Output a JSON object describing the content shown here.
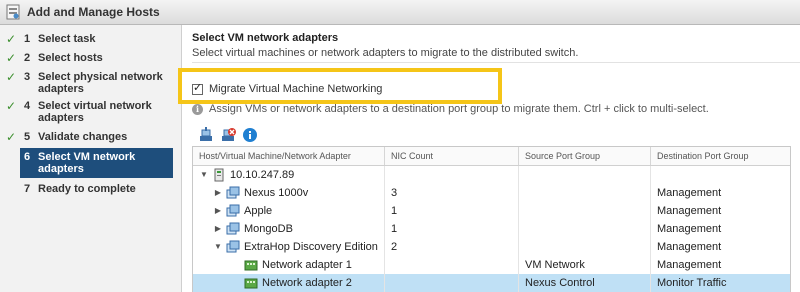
{
  "window": {
    "title": "Add and Manage Hosts"
  },
  "steps": [
    {
      "num": "1",
      "label": "Select task",
      "done": true
    },
    {
      "num": "2",
      "label": "Select hosts",
      "done": true
    },
    {
      "num": "3",
      "label": "Select physical network adapters",
      "done": true
    },
    {
      "num": "4",
      "label": "Select virtual network adapters",
      "done": true
    },
    {
      "num": "5",
      "label": "Validate changes",
      "done": true
    },
    {
      "num": "6",
      "label": "Select VM network adapters",
      "active": true
    },
    {
      "num": "7",
      "label": "Ready to complete"
    }
  ],
  "main": {
    "heading": "Select VM network adapters",
    "subheading": "Select virtual machines or network adapters to migrate to the distributed switch.",
    "migrate_label": "Migrate Virtual Machine Networking",
    "migrate_checked": true,
    "info_text": "Assign VMs or network adapters to a destination port group to migrate them. Ctrl + click to multi-select.",
    "info_icon": "i"
  },
  "table": {
    "columns": [
      "Host/Virtual Machine/Network Adapter",
      "NIC Count",
      "Source Port Group",
      "Destination Port Group"
    ],
    "rows": [
      {
        "name": "10.10.247.89",
        "nic": "",
        "src": "",
        "dst": ""
      },
      {
        "name": "Nexus 1000v",
        "nic": "3",
        "src": "",
        "dst": "Management"
      },
      {
        "name": "Apple",
        "nic": "1",
        "src": "",
        "dst": "Management"
      },
      {
        "name": "MongoDB",
        "nic": "1",
        "src": "",
        "dst": "Management"
      },
      {
        "name": "ExtraHop Discovery Edition",
        "nic": "2",
        "src": "",
        "dst": "Management"
      },
      {
        "name": "Network adapter 1",
        "nic": "",
        "src": "VM Network",
        "dst": "Management"
      },
      {
        "name": "Network adapter 2",
        "nic": "",
        "src": "Nexus Control",
        "dst": "Monitor Traffic"
      }
    ]
  },
  "colors": {
    "accent": "#1e4e7c",
    "highlight": "#f5c518",
    "check": "#3c8f2e",
    "selected_row": "#bfe0f5"
  },
  "icons": {
    "check": "✓",
    "expanded": "▼",
    "collapsed": "▶"
  }
}
